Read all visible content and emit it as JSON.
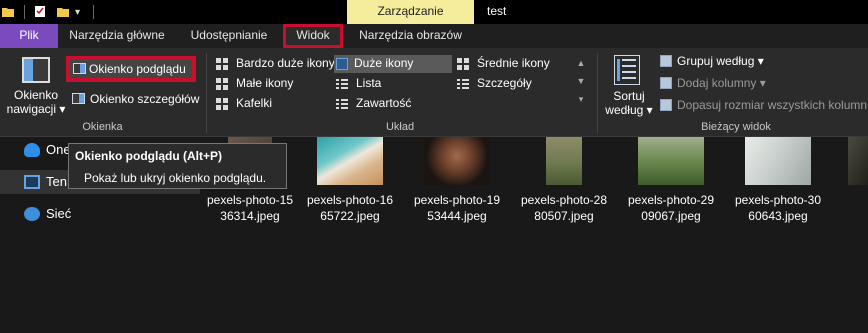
{
  "titlebar": {
    "context_tab_label": "Zarządzanie",
    "window_title": "test",
    "quick_access_icons": [
      "folder-icon",
      "properties-check-icon",
      "new-folder-icon",
      "customize-dropdown-icon"
    ]
  },
  "tabs": [
    {
      "label": "Plik",
      "active": false
    },
    {
      "label": "Narzędzia główne",
      "active": false
    },
    {
      "label": "Udostępnianie",
      "active": false
    },
    {
      "label": "Widok",
      "active": true,
      "highlighted": true
    },
    {
      "label": "Narzędzia obrazów",
      "active": false
    }
  ],
  "ribbon": {
    "panes_group": {
      "label": "Okienka",
      "nav_pane_label_1": "Okienko",
      "nav_pane_label_2": "nawigacji",
      "preview_pane_label": "Okienko podglądu",
      "details_pane_label": "Okienko szczegółów"
    },
    "layout_group": {
      "label": "Układ",
      "items": [
        {
          "label": "Bardzo duże ikony",
          "icon": "extra-large-icons-icon",
          "selected": false
        },
        {
          "label": "Duże ikony",
          "icon": "large-icons-icon",
          "selected": true
        },
        {
          "label": "Średnie ikony",
          "icon": "medium-icons-icon",
          "selected": false
        },
        {
          "label": "Małe ikony",
          "icon": "small-icons-icon",
          "selected": false
        },
        {
          "label": "Lista",
          "icon": "list-icon",
          "selected": false
        },
        {
          "label": "Szczegóły",
          "icon": "details-icon",
          "selected": false
        },
        {
          "label": "Kafelki",
          "icon": "tiles-icon",
          "selected": false
        },
        {
          "label": "Zawartość",
          "icon": "content-icon",
          "selected": false
        }
      ]
    },
    "current_view_group": {
      "label": "Bieżący widok",
      "sort_label_1": "Sortuj",
      "sort_label_2": "według",
      "group_by": "Grupuj według",
      "add_columns": "Dodaj kolumny",
      "fit_columns": "Dopasuj rozmiar wszystkich kolumn"
    }
  },
  "tooltip": {
    "title": "Okienko podglądu (Alt+P)",
    "description": "Pokaż lub ukryj okienko podglądu."
  },
  "navigation": {
    "items": [
      {
        "label": "One",
        "icon": "onedrive-cloud-icon"
      },
      {
        "label": "Ten k",
        "icon": "this-pc-icon"
      },
      {
        "label": "Sieć",
        "icon": "network-icon"
      }
    ]
  },
  "files": [
    {
      "line1": "pexels-photo-15",
      "line2": "36314.jpeg"
    },
    {
      "line1": "pexels-photo-16",
      "line2": "65722.jpeg"
    },
    {
      "line1": "pexels-photo-19",
      "line2": "53444.jpeg"
    },
    {
      "line1": "pexels-photo-28",
      "line2": "80507.jpeg"
    },
    {
      "line1": "pexels-photo-29",
      "line2": "09067.jpeg"
    },
    {
      "line1": "pexels-photo-30",
      "line2": "60643.jpeg"
    }
  ],
  "colors": {
    "file_tab": "#7b4bbd",
    "context_tab": "#f5ec9c",
    "highlight_border": "#c8102e",
    "background": "#191919",
    "ribbon": "#2b2b2b"
  }
}
